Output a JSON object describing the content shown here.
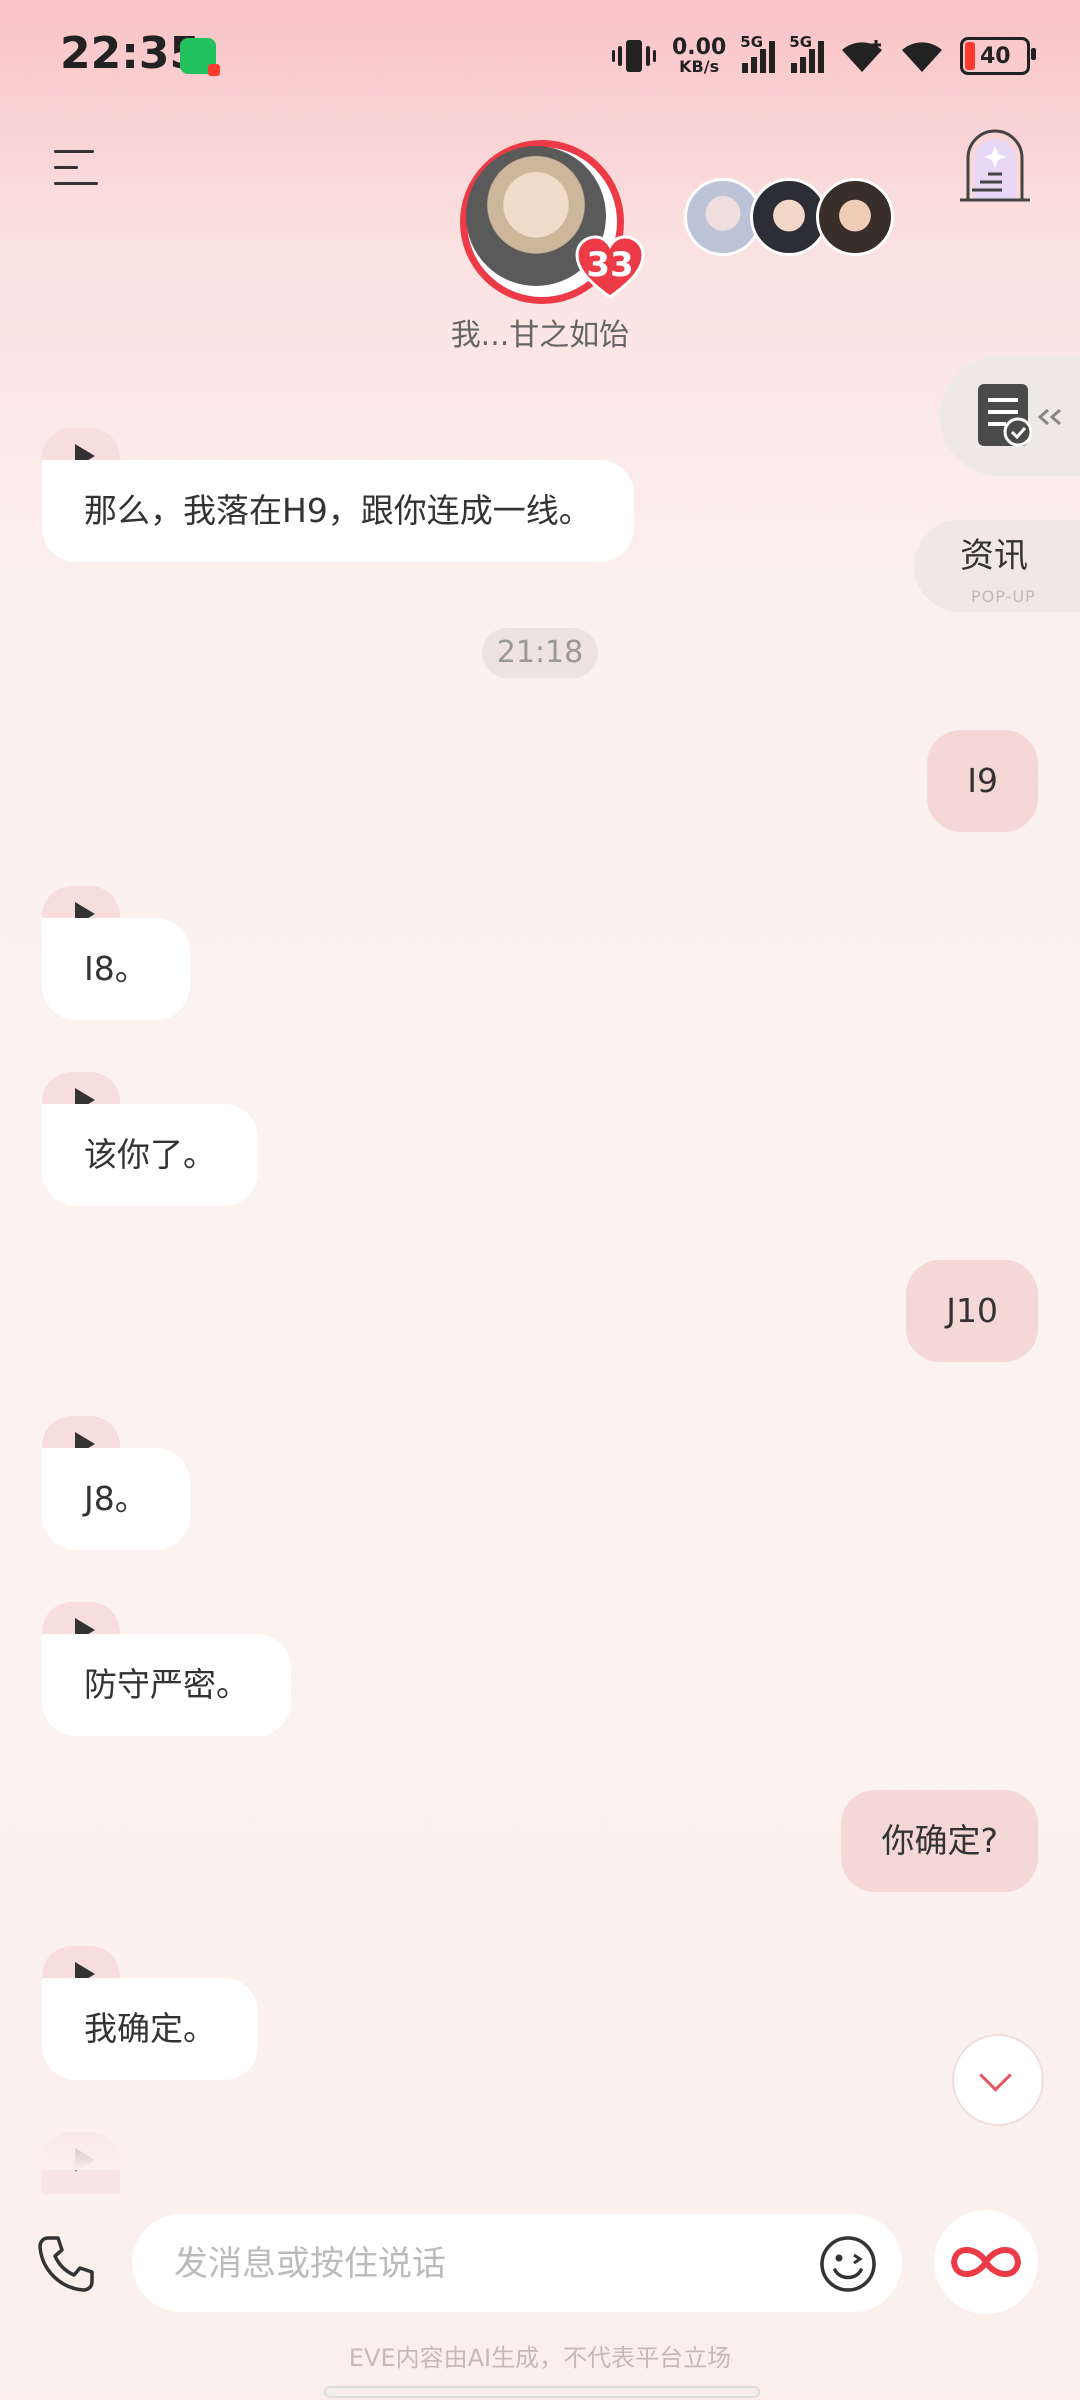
{
  "status_bar": {
    "time": "22:35",
    "net_speed_value": "0.00",
    "net_speed_unit": "KB/s",
    "signal_1_label": "5G",
    "signal_2_label": "5G",
    "battery": "40"
  },
  "header": {
    "character_name": "我...甘之如饴",
    "affection_level": "33",
    "popup": {
      "title": "资讯",
      "subtitle": "POP-UP"
    }
  },
  "messages": [
    {
      "side": "left",
      "text": "那么，我落在H9，跟你连成一线。"
    },
    {
      "type": "time",
      "text": "21:18"
    },
    {
      "side": "right",
      "text": "I9"
    },
    {
      "side": "left",
      "text": "I8。"
    },
    {
      "side": "left",
      "text": "该你了。"
    },
    {
      "side": "right",
      "text": "J10"
    },
    {
      "side": "left",
      "text": "J8。"
    },
    {
      "side": "left",
      "text": "防守严密。"
    },
    {
      "side": "right",
      "text": "你确定?"
    },
    {
      "side": "left",
      "text": "我确定。"
    }
  ],
  "composer": {
    "placeholder": "发消息或按住说话"
  },
  "footer": {
    "disclaimer": "EVE内容由AI生成，不代表平台立场"
  },
  "colors": {
    "accent": "#ec3a46",
    "user_bubble": "#f5d7d6",
    "bot_bubble": "#ffffff"
  },
  "icons": [
    "wechat-icon",
    "vibrate-icon",
    "signal-icon",
    "wifi-icon",
    "battery-icon",
    "menu-icon",
    "door-icon",
    "task-icon",
    "play-icon",
    "chevron-down-icon",
    "phone-icon",
    "emoji-icon",
    "infinity-icon"
  ]
}
